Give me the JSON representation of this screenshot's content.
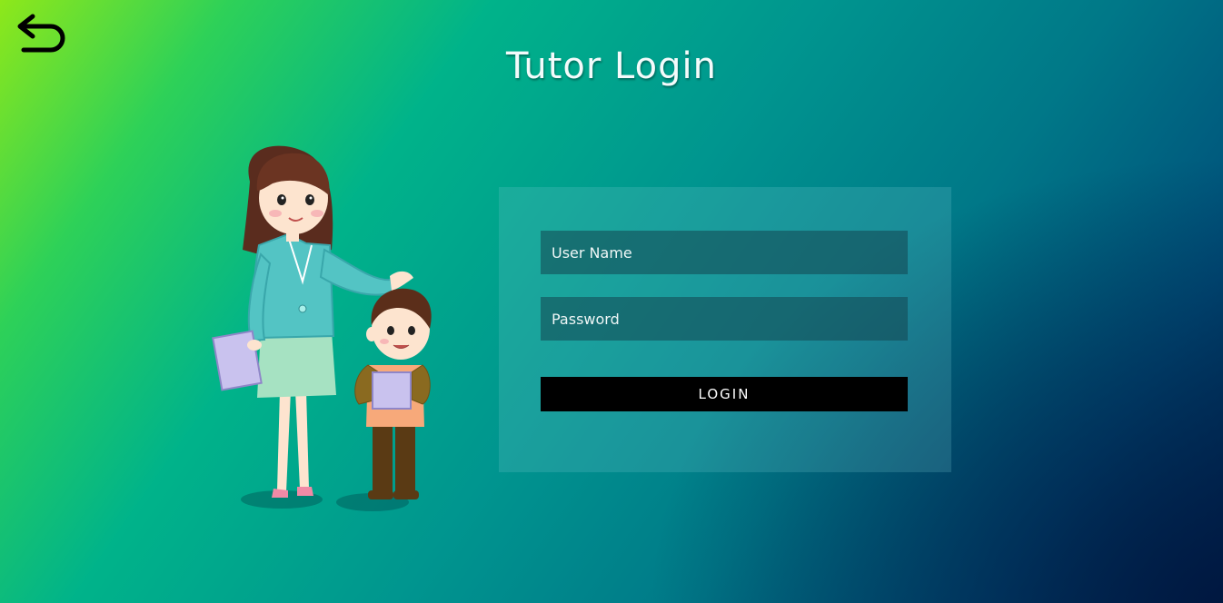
{
  "header": {
    "back_icon": "back-arrow-icon",
    "title": "Tutor Login"
  },
  "illustration": {
    "subject": "teacher-and-student-illustration"
  },
  "login_form": {
    "username_placeholder": "User Name",
    "username_value": "",
    "password_placeholder": "Password",
    "password_value": "",
    "login_label": "LOGIN"
  },
  "colors": {
    "gradient_top_left": "#8ee81a",
    "gradient_middle": "#00958f",
    "gradient_bottom_right": "#002b58",
    "button": "#000000",
    "title_text": "#f4fbfb"
  }
}
